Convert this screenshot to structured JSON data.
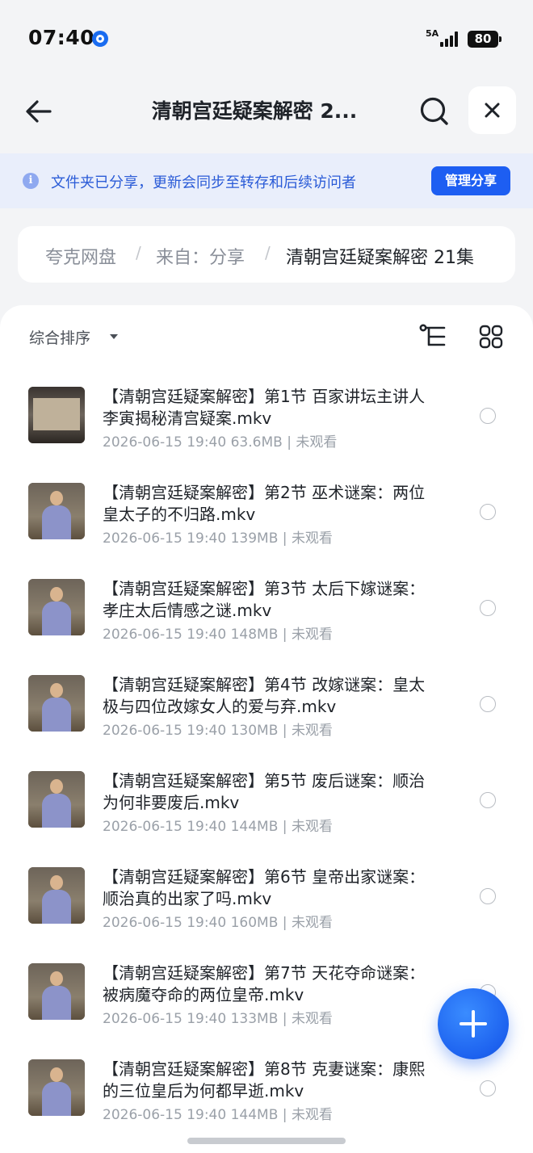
{
  "status_bar": {
    "time": "07:40",
    "network": "5A",
    "battery": "80"
  },
  "nav": {
    "title": "清朝宫廷疑案解密  2..."
  },
  "banner": {
    "text": "文件夹已分享，更新会同步至转存和后续访问者",
    "manage_label": "管理分享"
  },
  "breadcrumb": {
    "root": "夸克网盘",
    "from": "来自：分享",
    "current": "清朝宫廷疑案解密  21集"
  },
  "toolbar": {
    "sort_label": "综合排序"
  },
  "files": [
    {
      "name": "【清朝宫廷疑案解密】第1节 百家讲坛主讲人李寅揭秘清宫疑案.mkv",
      "date": "2026-06-15 19:40",
      "size": "63.6MB",
      "status": "未观看"
    },
    {
      "name": "【清朝宫廷疑案解密】第2节 巫术谜案：两位皇太子的不归路.mkv",
      "date": "2026-06-15 19:40",
      "size": "139MB",
      "status": "未观看"
    },
    {
      "name": "【清朝宫廷疑案解密】第3节 太后下嫁谜案：孝庄太后情感之谜.mkv",
      "date": "2026-06-15 19:40",
      "size": "148MB",
      "status": "未观看"
    },
    {
      "name": "【清朝宫廷疑案解密】第4节 改嫁谜案：皇太极与四位改嫁女人的爱与弃.mkv",
      "date": "2026-06-15 19:40",
      "size": "130MB",
      "status": "未观看"
    },
    {
      "name": "【清朝宫廷疑案解密】第5节 废后谜案：顺治为何非要废后.mkv",
      "date": "2026-06-15 19:40",
      "size": "144MB",
      "status": "未观看"
    },
    {
      "name": "【清朝宫廷疑案解密】第6节 皇帝出家谜案：顺治真的出家了吗.mkv",
      "date": "2026-06-15 19:40",
      "size": "160MB",
      "status": "未观看"
    },
    {
      "name": "【清朝宫廷疑案解密】第7节 天花夺命谜案：被病魔夺命的两位皇帝.mkv",
      "date": "2026-06-15 19:40",
      "size": "133MB",
      "status": "未观看"
    },
    {
      "name": "【清朝宫廷疑案解密】第8节 克妻谜案：康熙的三位皇后为何都早逝.mkv",
      "date": "2026-06-15 19:40",
      "size": "144MB",
      "status": "未观看"
    }
  ],
  "icons": {
    "back": "arrow-left-icon",
    "search": "search-icon",
    "close": "close-icon",
    "info": "info-icon",
    "tree": "directory-tree-icon",
    "grid": "grid-view-icon",
    "add": "plus-icon"
  },
  "colors": {
    "accent": "#1d5ef2",
    "banner_bg": "#e9eefb",
    "banner_text": "#2a5bd7",
    "meta_text": "#9aa0a8"
  }
}
